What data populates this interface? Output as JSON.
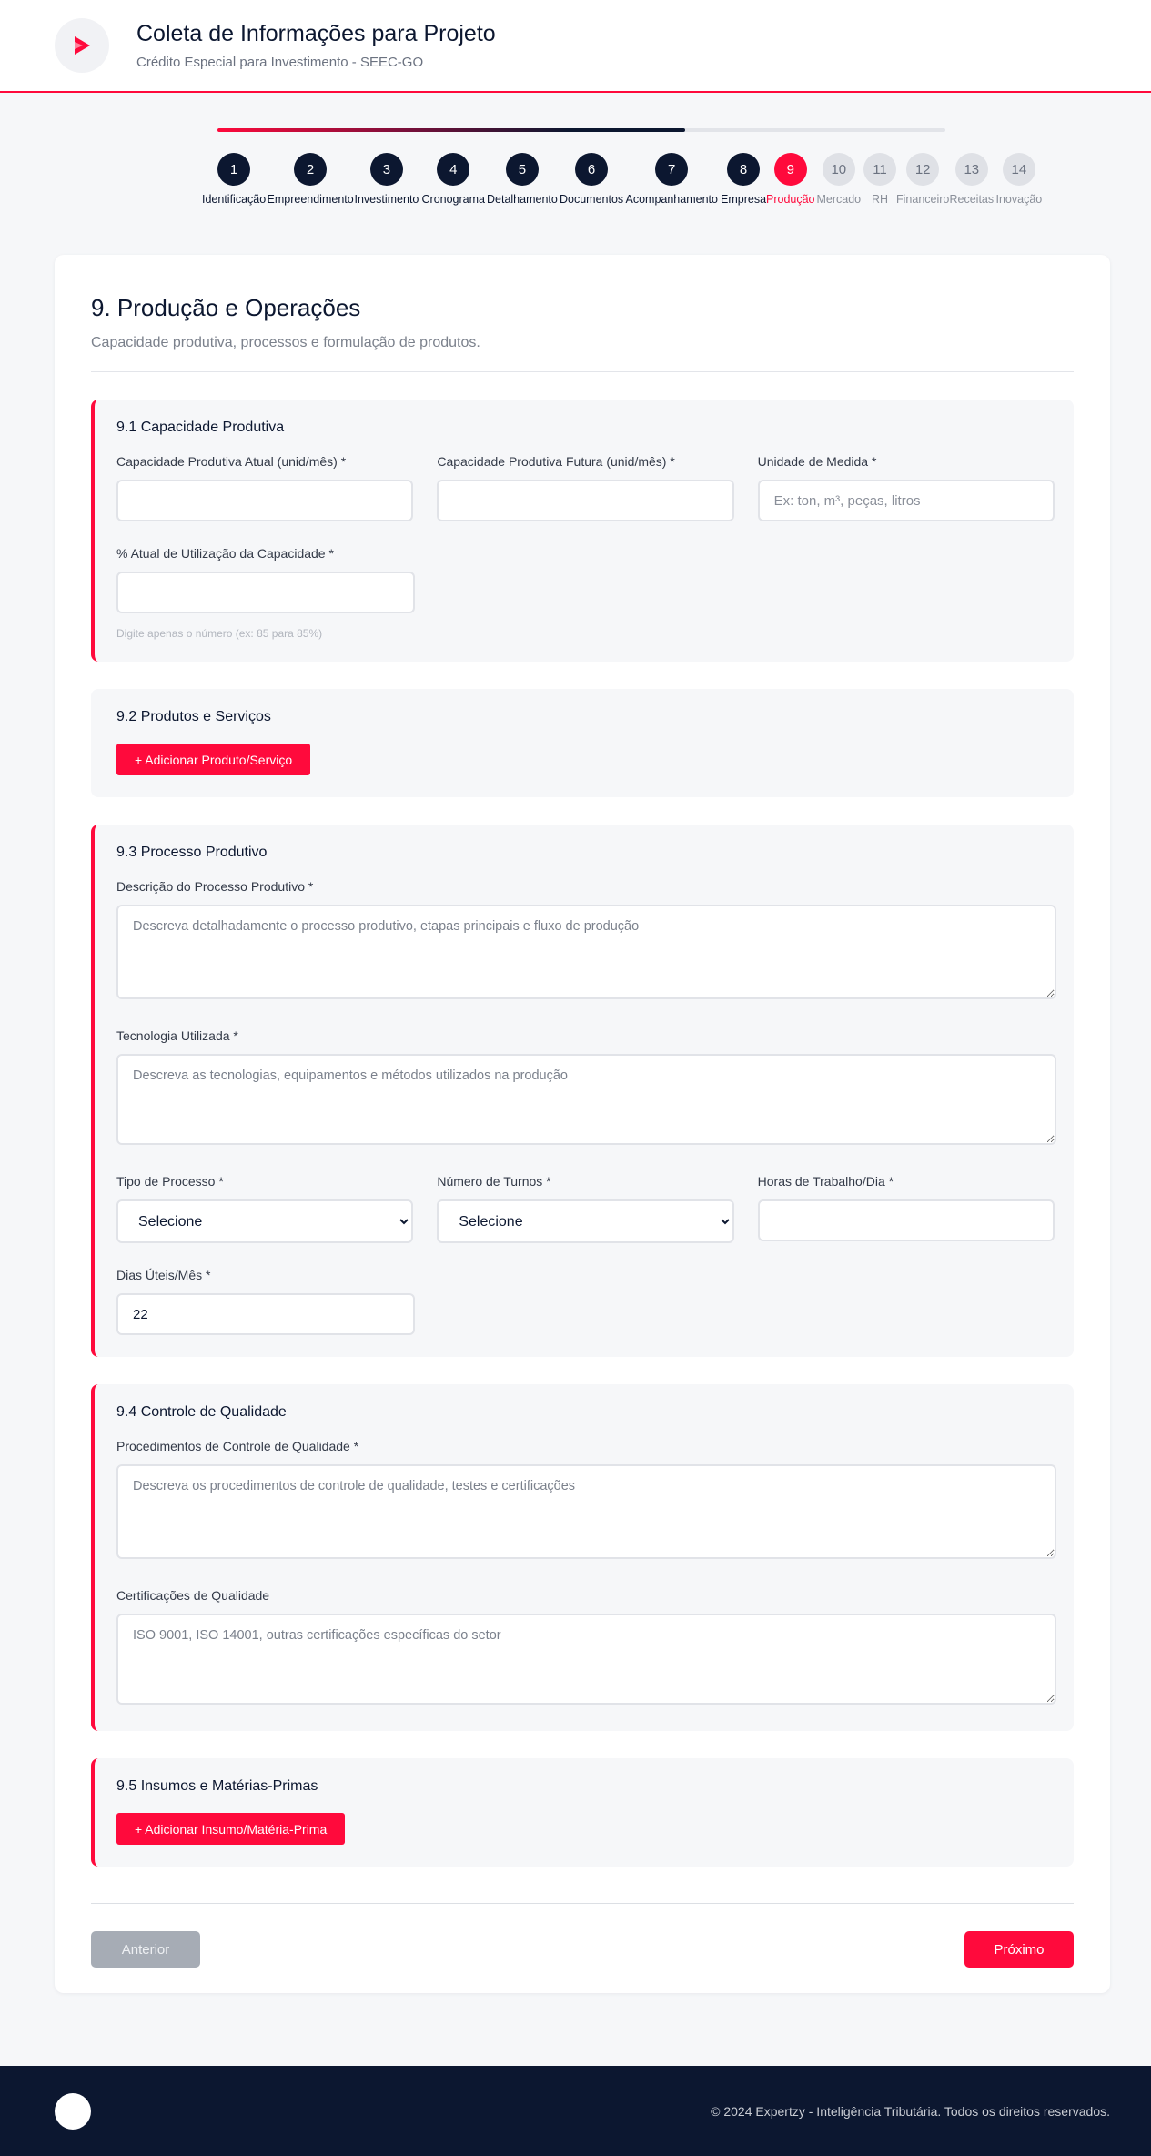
{
  "header": {
    "title": "Coleta de Informações para Projeto",
    "subtitle": "Crédito Especial para Investimento - SEEC-GO",
    "brand_color": "#ff0a3c"
  },
  "stepper": {
    "progress_fraction": 0.643,
    "steps": [
      {
        "number": "1",
        "label": "Identificação",
        "state": "done"
      },
      {
        "number": "2",
        "label": "Empreendimento",
        "state": "done"
      },
      {
        "number": "3",
        "label": "Investimento",
        "state": "done"
      },
      {
        "number": "4",
        "label": "Cronograma",
        "state": "done"
      },
      {
        "number": "5",
        "label": "Detalhamento",
        "state": "done"
      },
      {
        "number": "6",
        "label": "Documentos",
        "state": "done"
      },
      {
        "number": "7",
        "label": "Acompanhamento",
        "state": "done"
      },
      {
        "number": "8",
        "label": "Empresa",
        "state": "done"
      },
      {
        "number": "9",
        "label": "Produção",
        "state": "active"
      },
      {
        "number": "10",
        "label": "Mercado",
        "state": "todo"
      },
      {
        "number": "11",
        "label": "RH",
        "state": "todo"
      },
      {
        "number": "12",
        "label": "Financeiro",
        "state": "todo"
      },
      {
        "number": "13",
        "label": "Receitas",
        "state": "todo"
      },
      {
        "number": "14",
        "label": "Inovação",
        "state": "todo"
      }
    ]
  },
  "page": {
    "title": "9. Produção e Operações",
    "subtitle": "Capacidade produtiva, processos e formulação de produtos."
  },
  "s1": {
    "title": "9.1 Capacidade Produtiva",
    "cap_atual_label": "Capacidade Produtiva Atual (unid/mês) *",
    "cap_futura_label": "Capacidade Produtiva Futura (unid/mês) *",
    "unidade_label": "Unidade de Medida *",
    "unidade_placeholder": "Ex: ton, m³, peças, litros",
    "utilizacao_label": "% Atual de Utilização da Capacidade *",
    "utilizacao_hint": "Digite apenas o número (ex: 85 para 85%)"
  },
  "s2": {
    "title": "9.2 Produtos e Serviços",
    "add_label": "+ Adicionar Produto/Serviço"
  },
  "s3": {
    "title": "9.3 Processo Produtivo",
    "descricao_label": "Descrição do Processo Produtivo *",
    "descricao_placeholder": "Descreva detalhadamente o processo produtivo, etapas principais e fluxo de produção",
    "tecnologia_label": "Tecnologia Utilizada *",
    "tecnologia_placeholder": "Descreva as tecnologias, equipamentos e métodos utilizados na produção",
    "tipo_label": "Tipo de Processo *",
    "tipo_value": "Selecione",
    "turnos_label": "Número de Turnos *",
    "turnos_value": "Selecione",
    "horas_label": "Horas de Trabalho/Dia *",
    "dias_label": "Dias Úteis/Mês *",
    "dias_value": "22"
  },
  "s4": {
    "title": "9.4 Controle de Qualidade",
    "proc_label": "Procedimentos de Controle de Qualidade *",
    "proc_placeholder": "Descreva os procedimentos de controle de qualidade, testes e certificações",
    "cert_label": "Certificações de Qualidade",
    "cert_placeholder": "ISO 9001, ISO 14001, outras certificações específicas do setor"
  },
  "s5": {
    "title": "9.5 Insumos e Matérias-Primas",
    "add_label": "+ Adicionar Insumo/Matéria-Prima"
  },
  "nav": {
    "prev_label": "Anterior",
    "next_label": "Próximo"
  },
  "footer": {
    "text": "© 2024 Expertzy - Inteligência Tributária. Todos os direitos reservados."
  }
}
